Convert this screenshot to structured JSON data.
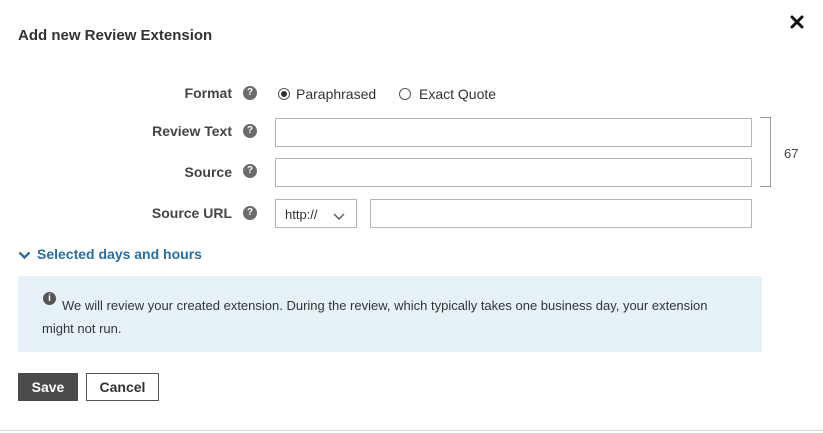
{
  "dialog": {
    "title": "Add new Review Extension",
    "close_icon": "close-icon"
  },
  "form": {
    "format": {
      "label": "Format",
      "options": [
        {
          "label": "Paraphrased",
          "selected": true
        },
        {
          "label": "Exact Quote",
          "selected": false
        }
      ]
    },
    "review_text": {
      "label": "Review Text",
      "value": ""
    },
    "source": {
      "label": "Source",
      "value": ""
    },
    "source_url": {
      "label": "Source URL",
      "protocol": "http://",
      "value": ""
    },
    "char_remaining": "67",
    "help_icon": "question-circle-icon"
  },
  "expander": {
    "label": "Selected days and hours",
    "icon": "chevron-down-icon"
  },
  "info": {
    "icon": "info-circle-icon",
    "text": "We will review your created extension. During the review, which typically takes one business day, your extension might not run."
  },
  "actions": {
    "save_label": "Save",
    "cancel_label": "Cancel"
  },
  "colors": {
    "link": "#2b6ea0",
    "info_bg": "#e6f2f8",
    "primary_button": "#4a4a4a"
  }
}
